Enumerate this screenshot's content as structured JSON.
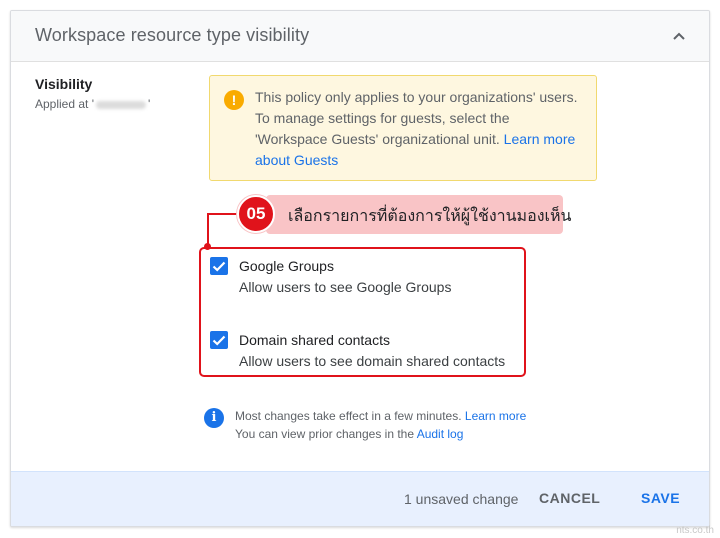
{
  "header": {
    "title": "Workspace resource type visibility",
    "collapse_icon": "chevron-up-icon"
  },
  "visibility": {
    "label": "Visibility",
    "applied_prefix": "Applied at '",
    "applied_suffix": "'"
  },
  "notice": {
    "icon": "warning-icon",
    "icon_glyph": "!",
    "text": "This policy only applies to your organizations' users. To manage settings for guests, select the 'Workspace Guests' organizational unit. ",
    "link": "Learn more about Guests"
  },
  "callout": {
    "step": "05",
    "text": "เลือกรายการที่ต้องการให้ผู้ใช้งานมองเห็น"
  },
  "options": [
    {
      "title": "Google Groups",
      "description": "Allow users to see Google Groups",
      "checked": true
    },
    {
      "title": "Domain shared contacts",
      "description": "Allow users to see domain shared contacts",
      "checked": true
    }
  ],
  "info": {
    "icon": "info-icon",
    "icon_glyph": "i",
    "line1": "Most changes take effect in a few minutes. ",
    "line1_link": "Learn more",
    "line2": "You can view prior changes in the ",
    "line2_link": "Audit log"
  },
  "footer": {
    "status": "1 unsaved change",
    "cancel_label": "CANCEL",
    "save_label": "SAVE"
  },
  "watermark": "nts.co.th",
  "colors": {
    "accent": "#1a73e8",
    "warning": "#f9ab00",
    "annotation": "#e0131b",
    "footer_bg": "#e8f0fe"
  }
}
